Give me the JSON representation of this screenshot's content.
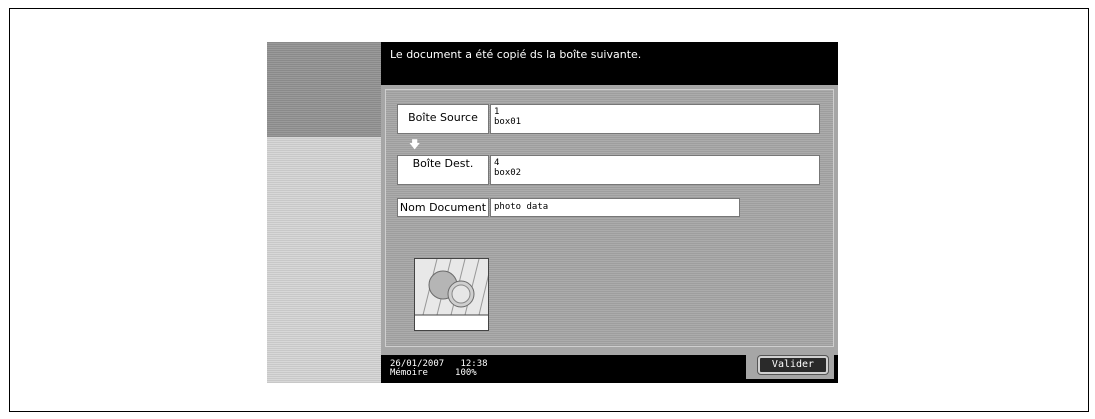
{
  "header": {
    "message": "Le document a été copié ds la boîte suivante."
  },
  "source": {
    "label": "Boîte Source",
    "number": "1",
    "name": "box01"
  },
  "dest": {
    "label": "Boîte Dest.",
    "number": "4",
    "name": "box02"
  },
  "document": {
    "label": "Nom Document",
    "value": "photo data"
  },
  "thumbnail": {
    "icon": "photo-thumbnail-icon"
  },
  "status": {
    "date": "26/01/2007",
    "time": "12:38",
    "memory_label": "Mémoire",
    "memory_value": "100%"
  },
  "buttons": {
    "valider": "Valider"
  }
}
